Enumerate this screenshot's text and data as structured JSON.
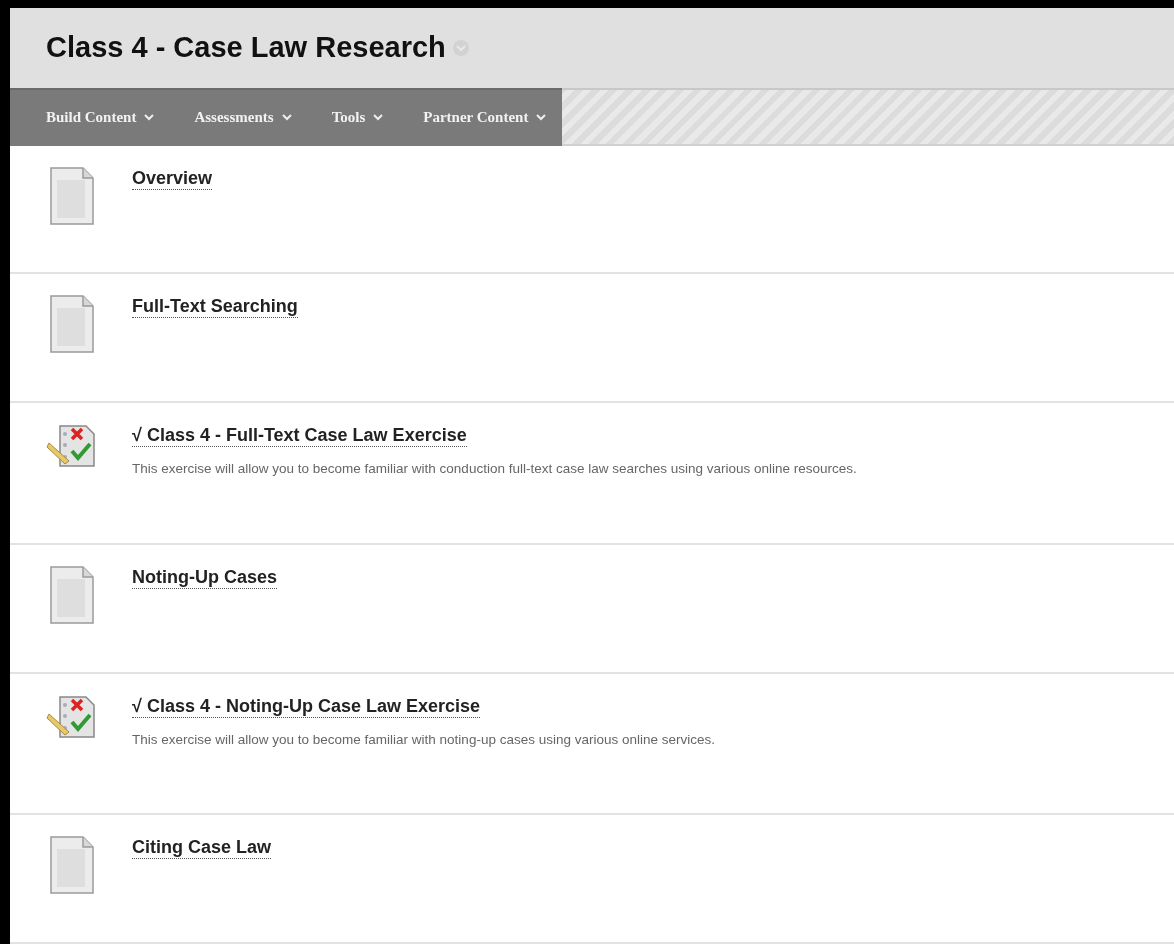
{
  "page": {
    "title": "Class 4 - Case Law Research"
  },
  "toolbar": [
    {
      "label": "Build Content"
    },
    {
      "label": "Assessments"
    },
    {
      "label": "Tools"
    },
    {
      "label": "Partner Content"
    }
  ],
  "items": [
    {
      "kind": "document",
      "title": "Overview"
    },
    {
      "kind": "document",
      "title": "Full-Text Searching"
    },
    {
      "kind": "test",
      "title": "√ Class 4 - Full-Text Case Law Exercise",
      "description": "This exercise will allow you to become familiar with conduction full-text case law searches using various online resources."
    },
    {
      "kind": "document",
      "title": "Noting-Up Cases"
    },
    {
      "kind": "test",
      "title": "√ Class 4 - Noting-Up Case Law Exercise",
      "description": "This exercise will allow you to become familiar with noting-up cases using various online services."
    },
    {
      "kind": "document",
      "title": "Citing Case Law"
    }
  ]
}
